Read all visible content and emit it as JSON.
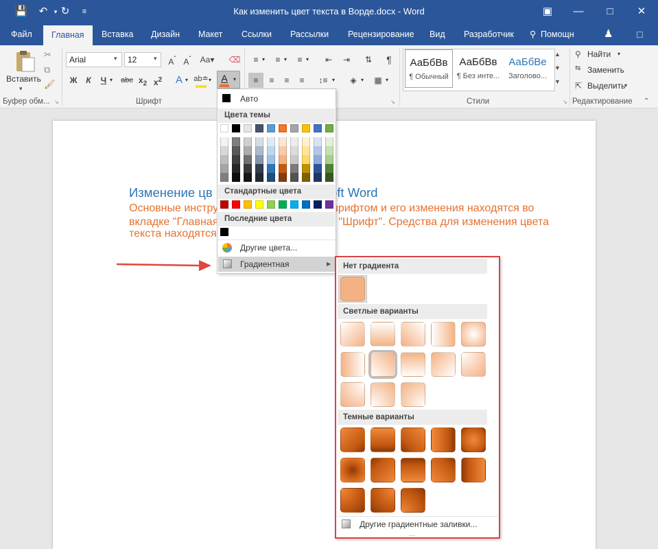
{
  "window": {
    "title": "Как изменить цвет текста в Ворде.docx - Word"
  },
  "tabs": [
    "Файл",
    "Главная",
    "Вставка",
    "Дизайн",
    "Макет",
    "Ссылки",
    "Рассылки",
    "Рецензирование",
    "Вид",
    "Разработчик",
    "Помощн"
  ],
  "ribbon": {
    "paste_label": "Вставить",
    "font_name": "Arial",
    "font_size": "12",
    "styles": [
      {
        "sample": "АаБбВв",
        "name": "¶ Обычный"
      },
      {
        "sample": "АаБбВв",
        "name": "¶ Без инте..."
      },
      {
        "sample": "АаБбВе",
        "name": "Заголово..."
      }
    ],
    "editing": {
      "find": "Найти",
      "replace": "Заменить",
      "select": "Выделить"
    },
    "groups": {
      "clipboard": "Буфер обм...",
      "font": "Шрифт",
      "styles": "Стили",
      "editing": "Редактирование"
    }
  },
  "document": {
    "heading": "Изменение цв",
    "heading_tail": "oft Word",
    "lines": [
      {
        "left": "Основные инстру",
        "right": "шрифтом и его изменения находятся во"
      },
      {
        "left": "вкладке \"Главная",
        "right": "е \"Шрифт\". Средства для изменения цвета"
      },
      {
        "left": "текста находятся",
        "right": ""
      }
    ]
  },
  "color_menu": {
    "auto_label": "Авто",
    "theme_header": "Цвета темы",
    "standard_header": "Стандартные цвета",
    "recent_header": "Последние цвета",
    "more_colors": "Другие цвета...",
    "gradient": "Градиентная",
    "theme_colors": [
      "#ffffff",
      "#000000",
      "#e7e6e6",
      "#44546a",
      "#5b9bd5",
      "#ed7d31",
      "#a5a5a5",
      "#ffc000",
      "#4472c4",
      "#70ad47"
    ],
    "theme_shades": [
      [
        "#f2f2f2",
        "#d8d8d8",
        "#bfbfbf",
        "#a5a5a5",
        "#7f7f7f"
      ],
      [
        "#7f7f7f",
        "#595959",
        "#3f3f3f",
        "#262626",
        "#0d0d0d"
      ],
      [
        "#d0cece",
        "#aeabab",
        "#757070",
        "#3a3838",
        "#171616"
      ],
      [
        "#d6dce4",
        "#adb9ca",
        "#8496b0",
        "#333f4f",
        "#222a35"
      ],
      [
        "#deebf6",
        "#bdd7ee",
        "#9dc3e6",
        "#2e75b5",
        "#1f4e79"
      ],
      [
        "#fbe5d5",
        "#f7cbac",
        "#f4b183",
        "#c45911",
        "#833c0b"
      ],
      [
        "#ededed",
        "#dbdbdb",
        "#c9c9c9",
        "#7b7b7b",
        "#525252"
      ],
      [
        "#fff2cc",
        "#fee599",
        "#ffd965",
        "#bf9000",
        "#7f6000"
      ],
      [
        "#dae3f3",
        "#b4c6e7",
        "#8eaadb",
        "#2f5496",
        "#1f3864"
      ],
      [
        "#e2efd9",
        "#c5e0b3",
        "#a8d08d",
        "#538135",
        "#375623"
      ]
    ],
    "standard_colors": [
      "#c00000",
      "#ff0000",
      "#ffc000",
      "#ffff00",
      "#92d050",
      "#00b050",
      "#00b0f0",
      "#0070c0",
      "#002060",
      "#7030a0"
    ],
    "recent_colors": [
      "#000000"
    ]
  },
  "gradient_panel": {
    "none_header": "Нет градиента",
    "light_header": "Светлые варианты",
    "dark_header": "Темные варианты",
    "more_label": "Другие градиентные заливки...",
    "base_color": "#f4b183",
    "dark_color": "#c45911"
  }
}
